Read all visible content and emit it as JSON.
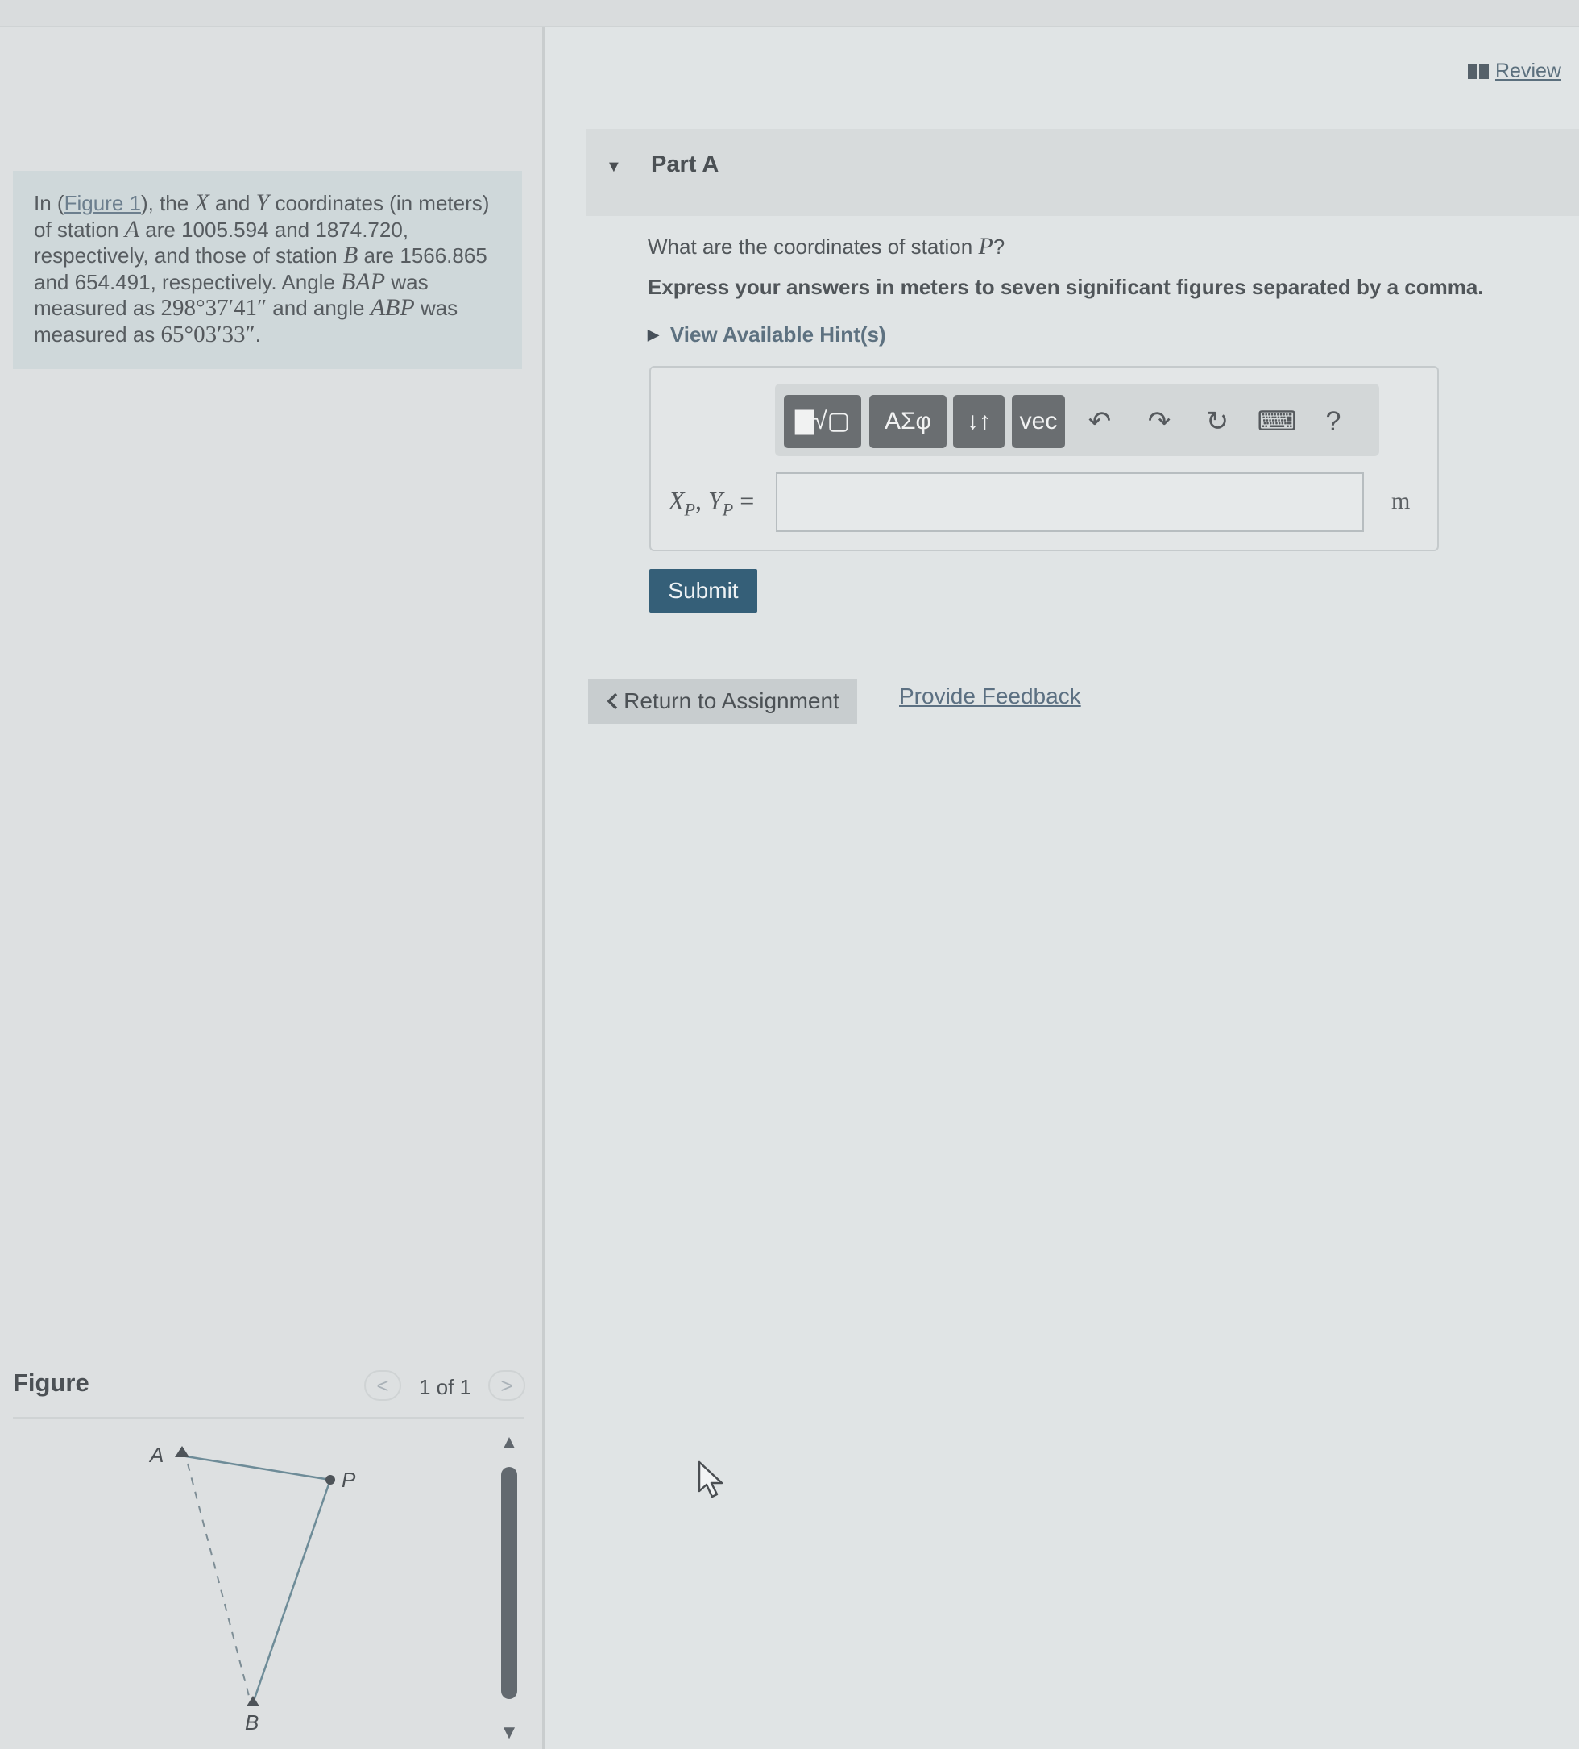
{
  "header": {
    "review_label": "Review"
  },
  "problem": {
    "p1": "In (",
    "figure_link": "Figure 1",
    "p2": "), the ",
    "x_sym": "X",
    "p3": " and ",
    "y_sym": "Y",
    "p4": " coordinates (in meters) of station ",
    "a_sym": "A",
    "p5": " are 1005.594 and 1874.720, respectively, and those of station ",
    "b_sym": "B",
    "p6": " are 1566.865 and 654.491, respectively. Angle ",
    "bap_sym": "BAP",
    "p7": " was measured as ",
    "angle1": "298°37′41″",
    "p8": " and angle ",
    "abp_sym": "ABP",
    "p9": " was measured as ",
    "angle2": "65°03′33″",
    "p10": "."
  },
  "figure": {
    "title": "Figure",
    "pager_prev": "<",
    "pager_text": "1 of 1",
    "pager_next": ">",
    "label_a": "A",
    "label_b": "B",
    "label_p": "P"
  },
  "part_a": {
    "title": "Part A",
    "question_prefix": "What are the coordinates of station ",
    "question_symbol": "P",
    "question_suffix": "?",
    "instruction": "Express your answers in meters to seven significant figures separated by a comma.",
    "hints_label": "View Available Hint(s)",
    "variable_x": "X",
    "variable_sub": "P",
    "variable_sep": ", ",
    "variable_y": "Y",
    "variable_eq": " =",
    "input_value": "",
    "unit": "m",
    "submit_label": "Submit"
  },
  "toolbar": {
    "template_btn": "▇√▢",
    "greek_btn": "ΑΣφ",
    "arrows_btn": "↓↑",
    "vec_btn": "vec",
    "undo_icon": "↶",
    "redo_icon": "↷",
    "reset_icon": "↻",
    "keyboard_icon": "⌨",
    "help_icon": "?"
  },
  "footer": {
    "return_label": "Return to Assignment",
    "feedback_label": "Provide Feedback"
  }
}
